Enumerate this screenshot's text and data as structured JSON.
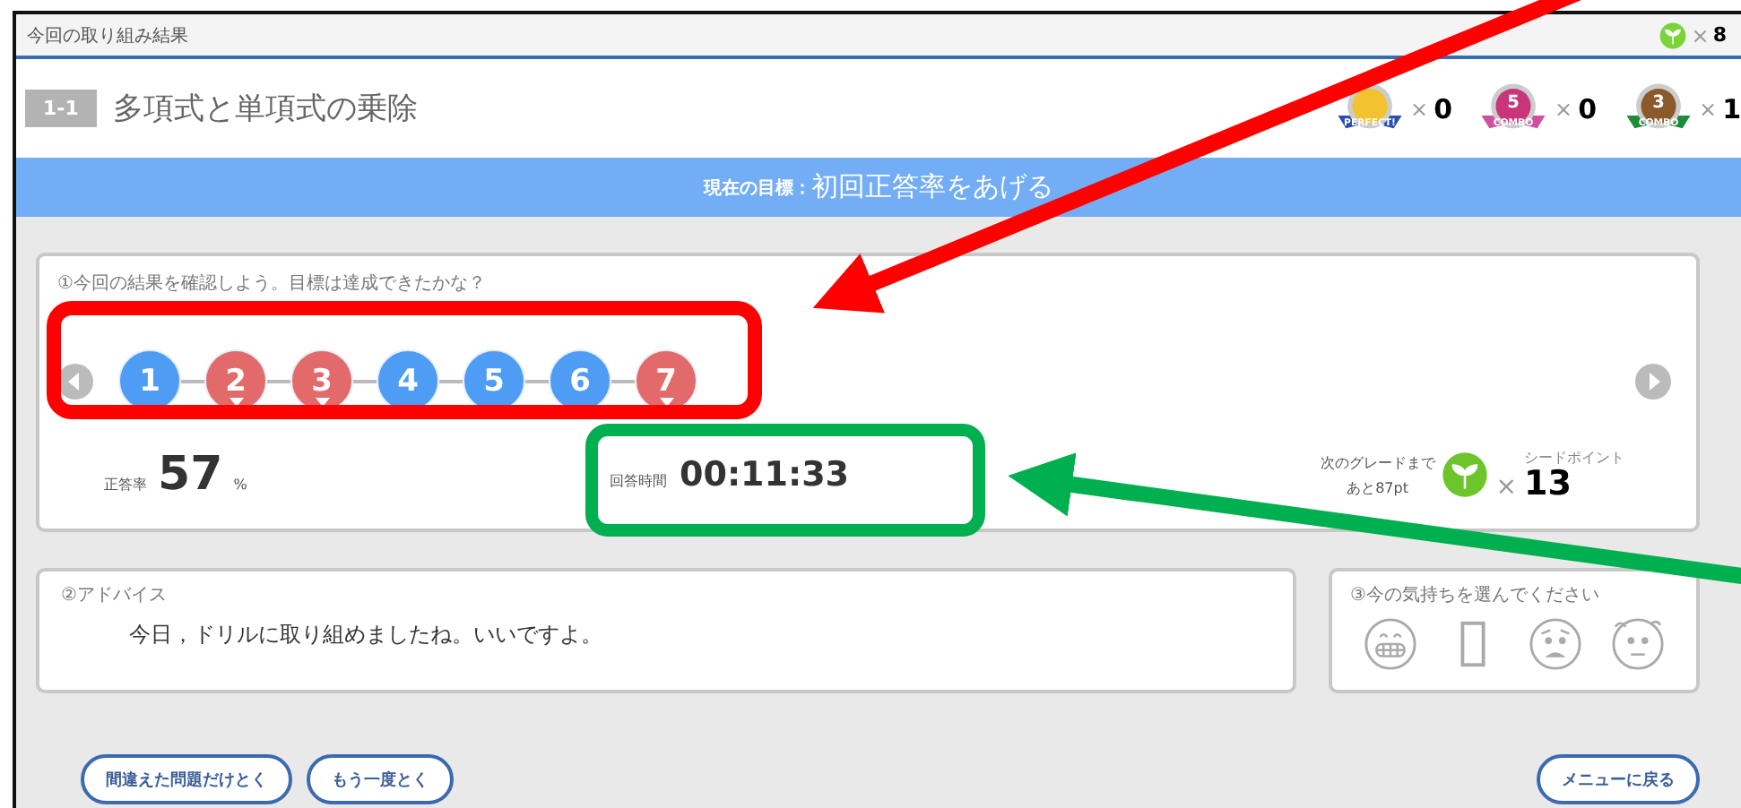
{
  "window": {
    "title": "今回の取り組み結果",
    "seed_multiplier": "×",
    "seed_count": "8"
  },
  "header": {
    "unit": "1-1",
    "title": "多項式と単項式の乗除",
    "badges": [
      {
        "kind": "perfect",
        "medal_text": "PERFECT!",
        "multiplier": "×",
        "count": "0"
      },
      {
        "kind": "combo5",
        "medal_number": "5",
        "medal_text": "COMBO",
        "multiplier": "×",
        "count": "0"
      },
      {
        "kind": "combo3",
        "medal_number": "3",
        "medal_text": "COMBO",
        "multiplier": "×",
        "count": "1"
      }
    ]
  },
  "goal": {
    "label": "現在の目標：",
    "text": "初回正答率をあげる"
  },
  "results": {
    "heading": "①今回の結果を確認しよう。目標は達成できたかな？",
    "questions": [
      {
        "number": "1",
        "correct": true
      },
      {
        "number": "2",
        "correct": false
      },
      {
        "number": "3",
        "correct": false
      },
      {
        "number": "4",
        "correct": true
      },
      {
        "number": "5",
        "correct": true
      },
      {
        "number": "6",
        "correct": true
      },
      {
        "number": "7",
        "correct": false
      }
    ],
    "accuracy": {
      "label": "正答率",
      "value": "57",
      "unit": "%"
    },
    "time": {
      "label": "回答時間",
      "value": "00:11:33"
    },
    "seeds": {
      "next_grade": "次のグレードまで",
      "remaining": "あと87pt",
      "caption": "シードポイント",
      "multiplier": "×",
      "count": "13"
    }
  },
  "advice": {
    "heading": "②アドバイス",
    "text": "今日，ドリルに取り組めましたね。いいですよ。"
  },
  "feelings": {
    "heading": "③今の気持ちを選んでください",
    "options": [
      {
        "kind": "grin",
        "selected": false
      },
      {
        "kind": "missing",
        "selected": false
      },
      {
        "kind": "worried",
        "selected": false
      },
      {
        "kind": "nervous",
        "selected": false
      }
    ]
  },
  "left_buttons": [
    {
      "label": "間違えた問題だけとく"
    },
    {
      "label": "もう一度とく"
    }
  ],
  "right_buttons": [
    {
      "label": "メニューに戻る"
    }
  ]
}
